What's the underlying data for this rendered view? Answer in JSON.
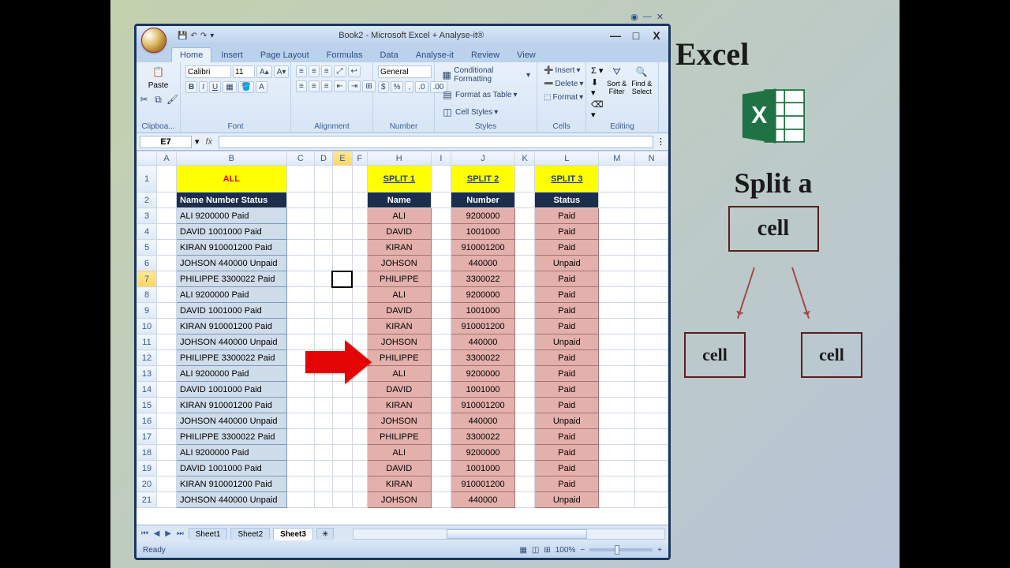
{
  "window": {
    "title": "Book2 - Microsoft Excel + Analyse-it®",
    "minimize": "—",
    "maximize": "□",
    "close": "X"
  },
  "qat": {
    "save": "💾",
    "undo": "↶",
    "redo": "↷"
  },
  "tabs": [
    "Home",
    "Insert",
    "Page Layout",
    "Formulas",
    "Data",
    "Analyse-it",
    "Review",
    "View"
  ],
  "ribbon": {
    "clipboard": {
      "label": "Clipboa...",
      "paste": "Paste"
    },
    "font": {
      "label": "Font",
      "name": "Calibri",
      "size": "11",
      "bold": "B",
      "italic": "I",
      "underline": "U"
    },
    "alignment": {
      "label": "Alignment"
    },
    "number": {
      "label": "Number",
      "format": "General"
    },
    "styles": {
      "label": "Styles",
      "cond": "Conditional Formatting",
      "table": "Format as Table",
      "cell": "Cell Styles"
    },
    "cells": {
      "label": "Cells",
      "insert": "Insert",
      "delete": "Delete",
      "format": "Format"
    },
    "editing": {
      "label": "Editing",
      "sort": "Sort & Filter",
      "find": "Find & Select"
    }
  },
  "namebox": "E7",
  "columns": [
    "A",
    "B",
    "C",
    "D",
    "E",
    "F",
    "H",
    "I",
    "J",
    "K",
    "L",
    "M",
    "N"
  ],
  "headers": {
    "all": "ALL",
    "s1": "SPLIT 1",
    "s2": "SPLIT 2",
    "s3": "SPLIT 3"
  },
  "row2": {
    "b": "Name Number Status",
    "h": "Name",
    "j": "Number",
    "l": "Status"
  },
  "data": [
    {
      "b": "ALI 9200000  Paid",
      "h": "ALI",
      "j": "9200000",
      "l": "Paid"
    },
    {
      "b": "DAVID 1001000 Paid",
      "h": "DAVID",
      "j": "1001000",
      "l": "Paid"
    },
    {
      "b": "KIRAN 910001200 Paid",
      "h": "KIRAN",
      "j": "910001200",
      "l": "Paid"
    },
    {
      "b": "JOHSON 440000 Unpaid",
      "h": "JOHSON",
      "j": "440000",
      "l": "Unpaid"
    },
    {
      "b": "PHILIPPE 3300022 Paid",
      "h": "PHILIPPE",
      "j": "3300022",
      "l": "Paid"
    },
    {
      "b": "ALI 9200000  Paid",
      "h": "ALI",
      "j": "9200000",
      "l": "Paid"
    },
    {
      "b": "DAVID 1001000 Paid",
      "h": "DAVID",
      "j": "1001000",
      "l": "Paid"
    },
    {
      "b": "KIRAN 910001200 Paid",
      "h": "KIRAN",
      "j": "910001200",
      "l": "Paid"
    },
    {
      "b": "JOHSON 440000 Unpaid",
      "h": "JOHSON",
      "j": "440000",
      "l": "Unpaid"
    },
    {
      "b": "PHILIPPE 3300022 Paid",
      "h": "PHILIPPE",
      "j": "3300022",
      "l": "Paid"
    },
    {
      "b": "ALI 9200000  Paid",
      "h": "ALI",
      "j": "9200000",
      "l": "Paid"
    },
    {
      "b": "DAVID 1001000 Paid",
      "h": "DAVID",
      "j": "1001000",
      "l": "Paid"
    },
    {
      "b": "KIRAN 910001200 Paid",
      "h": "KIRAN",
      "j": "910001200",
      "l": "Paid"
    },
    {
      "b": "JOHSON 440000 Unpaid",
      "h": "JOHSON",
      "j": "440000",
      "l": "Unpaid"
    },
    {
      "b": "PHILIPPE 3300022 Paid",
      "h": "PHILIPPE",
      "j": "3300022",
      "l": "Paid"
    },
    {
      "b": "ALI 9200000  Paid",
      "h": "ALI",
      "j": "9200000",
      "l": "Paid"
    },
    {
      "b": "DAVID 1001000 Paid",
      "h": "DAVID",
      "j": "1001000",
      "l": "Paid"
    },
    {
      "b": "KIRAN 910001200 Paid",
      "h": "KIRAN",
      "j": "910001200",
      "l": "Paid"
    },
    {
      "b": "JOHSON 440000 Unpaid",
      "h": "JOHSON",
      "j": "440000",
      "l": "Unpaid"
    }
  ],
  "sheets": {
    "s1": "Sheet1",
    "s2": "Sheet2",
    "s3": "Sheet3"
  },
  "status": {
    "ready": "Ready",
    "zoom": "100%"
  },
  "slide": {
    "t1": "Excel",
    "t2": "Split a",
    "cell": "cell"
  }
}
